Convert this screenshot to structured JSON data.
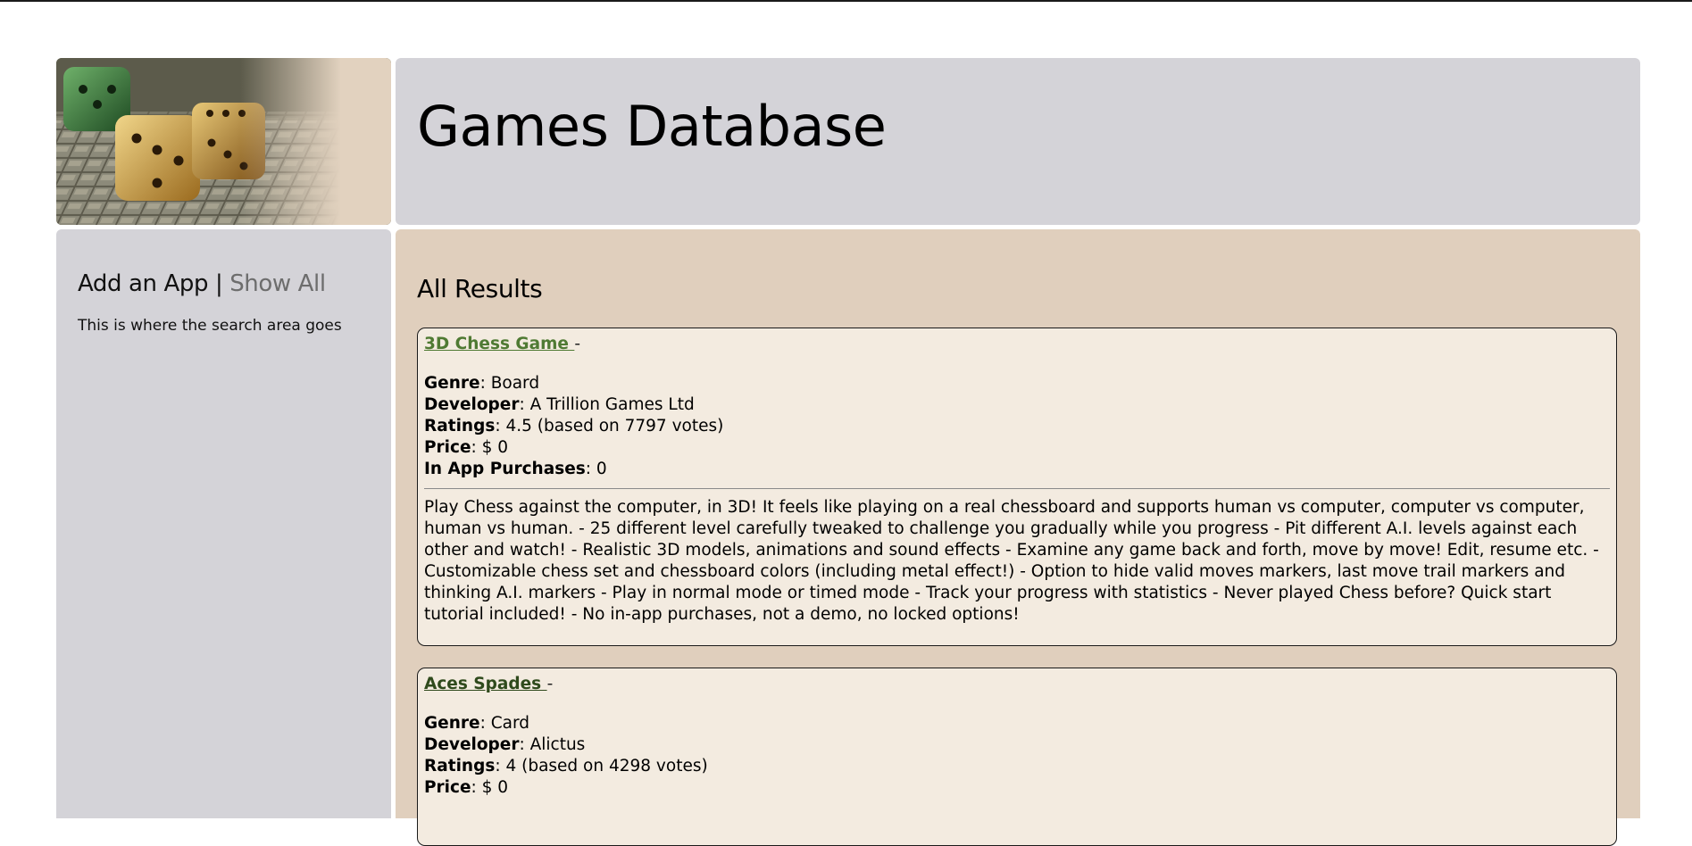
{
  "header": {
    "title": "Games Database"
  },
  "sidebar": {
    "add_label": "Add an App",
    "separator": "|",
    "show_all_label": "Show All",
    "note": "This is where the search area goes"
  },
  "main": {
    "heading": "All Results",
    "results": [
      {
        "title": "3D Chess Game ",
        "dash": "-",
        "genre_label": "Genre",
        "genre": ": Board",
        "developer_label": "Developer",
        "developer": ": A Trillion Games Ltd",
        "ratings_label": "Ratings",
        "ratings": ": 4.5 (based on 7797 votes)",
        "price_label": "Price",
        "price": ": $ 0",
        "iap_label": "In App Purchases",
        "iap": ": 0",
        "description": "Play Chess against the computer, in 3D! It feels like playing on a real chessboard and supports human vs computer, computer vs computer, human vs human. - 25 different level carefully tweaked to challenge you gradually while you progress - Pit different A.I. levels against each other and watch! - Realistic 3D models, animations and sound effects - Examine any game back and forth, move by move! Edit, resume etc. - Customizable chess set and chessboard colors (including metal effect!) - Option to hide valid moves markers, last move trail markers and thinking A.I. markers - Play in normal mode or timed mode - Track your progress with statistics - Never played Chess before? Quick start tutorial included! - No in-app purchases, not a demo, no locked options!"
      },
      {
        "title": "Aces Spades ",
        "dash": "-",
        "genre_label": "Genre",
        "genre": ": Card",
        "developer_label": "Developer",
        "developer": ": Alictus",
        "ratings_label": "Ratings",
        "ratings": ": 4 (based on 4298 votes)",
        "price_label": "Price",
        "price": ": $ 0"
      }
    ]
  },
  "colors": {
    "panel_gray": "#d4d3d8",
    "panel_tan": "#e0cfbd",
    "card_bg": "#f3ebe0",
    "link_green": "#4f7a33",
    "link_dark_green": "#2f4a1c",
    "show_all_gray": "#6d6d6d"
  }
}
